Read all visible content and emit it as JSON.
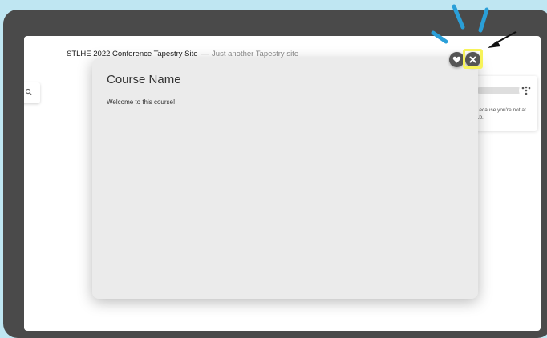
{
  "site": {
    "title": "STLHE 2022 Conference Tapestry Site",
    "separator": "—",
    "tagline": "Just another Tapestry site"
  },
  "modal": {
    "title": "Course Name",
    "body": "Welcome to this course!",
    "favorite_icon": "heart-icon",
    "close_icon": "close-icon"
  },
  "sidebar": {
    "search_icon": "search-icon",
    "card_text": "...ecause you're not at ...b."
  },
  "annotations": {
    "highlight_color": "#f7f35a",
    "ray_color": "#2a9fd8",
    "arrow_color": "#111111"
  },
  "colors": {
    "frame": "#4a4a4a",
    "background": "#bfe6f2",
    "modal": "#ebebeb"
  }
}
